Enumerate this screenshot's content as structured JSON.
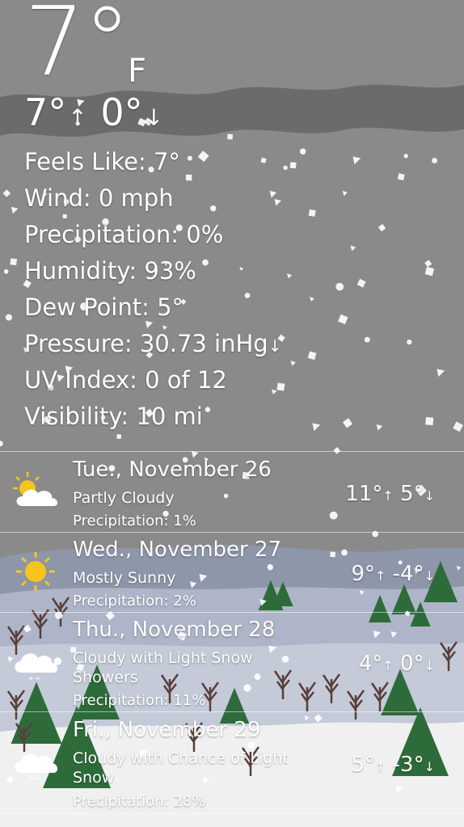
{
  "colors": {
    "sky": "#8a8a8a",
    "cloud_band": "#6e6e6e",
    "far_hills": "#8f97ac",
    "mid_field": "#b8bfd0",
    "snow_ground": "#f2f2f2",
    "pine": "#2e6b3a",
    "sun": "#f6c51b"
  },
  "current": {
    "temp": "7°",
    "unit": "F",
    "high": "7°",
    "low": "0°",
    "up_arrow": "↑",
    "down_arrow": "↓",
    "feels_like": "Feels Like: 7°",
    "wind": "Wind: 0 mph",
    "precipitation": "Precipitation: 0%",
    "humidity": "Humidity: 93%",
    "dew_point": "Dew Point: 5°",
    "pressure": "Pressure: 30.73 inHg",
    "pressure_trend": "↓",
    "uv_index": "UV Index: 0 of 12",
    "visibility": "Visibility: 10 mi"
  },
  "forecast": [
    {
      "icon": "partly-cloudy-icon",
      "day": "Tue., November 26",
      "condition": "Partly Cloudy",
      "precip": "Precipitation: 1%",
      "high": "11°",
      "low": "5°"
    },
    {
      "icon": "sun-icon",
      "day": "Wed., November 27",
      "condition": "Mostly Sunny",
      "precip": "Precipitation: 2%",
      "high": "9°",
      "low": "-4°"
    },
    {
      "icon": "cloud-snow-icon",
      "day": "Thu., November 28",
      "condition": "Cloudy with Light Snow Showers",
      "precip": "Precipitation: 11%",
      "high": "4°",
      "low": "0°"
    },
    {
      "icon": "cloud-snow-icon",
      "day": "Fri., November 29",
      "condition": "Cloudy with Chance of Light Snow",
      "precip": "Precipitation: 28%",
      "high": "5°",
      "low": "-3°"
    }
  ]
}
